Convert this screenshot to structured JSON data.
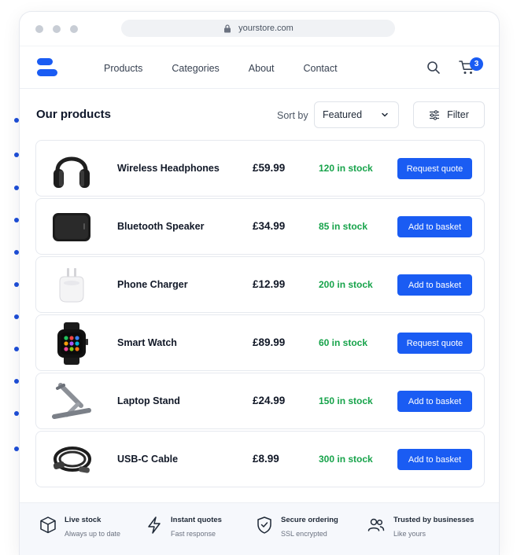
{
  "browser": {
    "url": "yourstore.com"
  },
  "nav": {
    "links": [
      "Products",
      "Categories",
      "About",
      "Contact"
    ],
    "cart_count": "3"
  },
  "toolbar": {
    "title": "Our products",
    "sort_label": "Sort by",
    "sort_value": "Featured",
    "filter_label": "Filter"
  },
  "products": [
    {
      "name": "Wireless Headphones",
      "price": "£59.99",
      "stock": "120 in stock",
      "action": "Request quote",
      "icon": "headphones-icon"
    },
    {
      "name": "Bluetooth Speaker",
      "price": "£34.99",
      "stock": "85 in stock",
      "action": "Add to basket",
      "icon": "speaker-icon"
    },
    {
      "name": "Phone Charger",
      "price": "£12.99",
      "stock": "200 in stock",
      "action": "Add to basket",
      "icon": "charger-icon"
    },
    {
      "name": "Smart Watch",
      "price": "£89.99",
      "stock": "60 in stock",
      "action": "Request quote",
      "icon": "smartwatch-icon"
    },
    {
      "name": "Laptop Stand",
      "price": "£24.99",
      "stock": "150 in stock",
      "action": "Add to basket",
      "icon": "laptop-stand-icon"
    },
    {
      "name": "USB-C Cable",
      "price": "£8.99",
      "stock": "300 in stock",
      "action": "Add to basket",
      "icon": "cable-icon"
    }
  ],
  "features": [
    {
      "title": "Live stock",
      "subtitle": "Always up to date",
      "icon": "box-icon"
    },
    {
      "title": "Instant quotes",
      "subtitle": "Fast response",
      "icon": "lightning-icon"
    },
    {
      "title": "Secure ordering",
      "subtitle": "SSL encrypted",
      "icon": "shield-check-icon"
    },
    {
      "title": "Trusted by businesses",
      "subtitle": "Like yours",
      "icon": "users-icon"
    }
  ],
  "colors": {
    "accent": "#1a5cf3",
    "stock": "#16a34a",
    "rail": "#1d4ed8"
  }
}
